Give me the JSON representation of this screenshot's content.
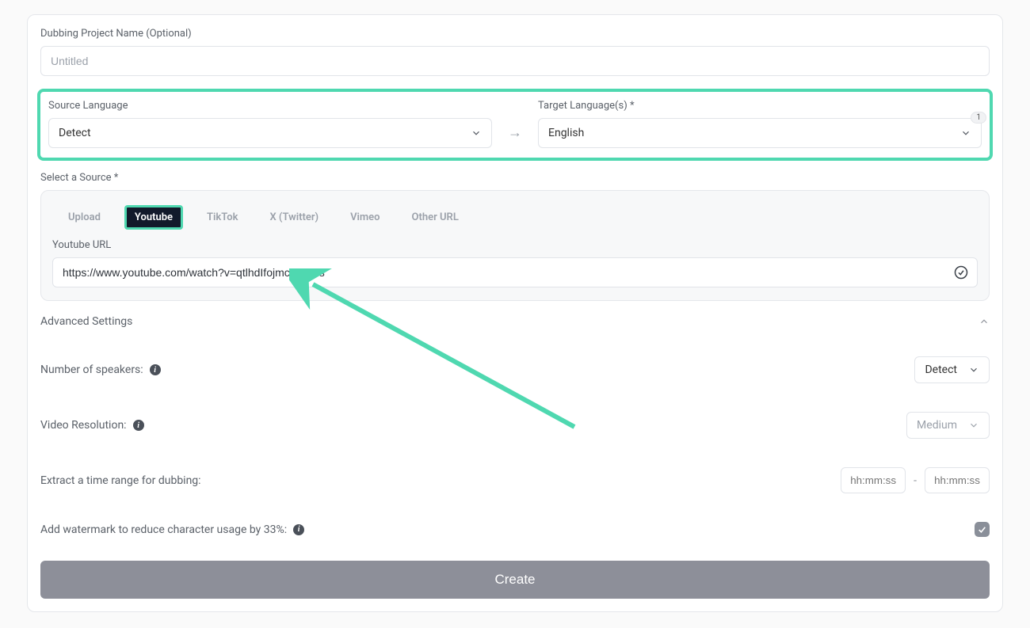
{
  "project_name": {
    "label": "Dubbing Project Name (Optional)",
    "value": "Untitled"
  },
  "source_language": {
    "label": "Source Language",
    "value": "Detect"
  },
  "target_language": {
    "label": "Target Language(s) *",
    "value": "English",
    "count": "1"
  },
  "source_section": {
    "label": "Select a Source *",
    "tabs": [
      "Upload",
      "Youtube",
      "TikTok",
      "X (Twitter)",
      "Vimeo",
      "Other URL"
    ],
    "url_label": "Youtube URL",
    "url_value": "https://www.youtube.com/watch?v=qtlhdIfojmc&t=30s"
  },
  "advanced": {
    "label": "Advanced Settings",
    "speakers_label": "Number of speakers:",
    "speakers_value": "Detect",
    "resolution_label": "Video Resolution:",
    "resolution_value": "Medium",
    "timerange_label": "Extract a time range for dubbing:",
    "timerange_placeholder": "hh:mm:ss",
    "timerange_separator": "-",
    "watermark_label": "Add watermark to reduce character usage by 33%:"
  },
  "create_button": "Create"
}
